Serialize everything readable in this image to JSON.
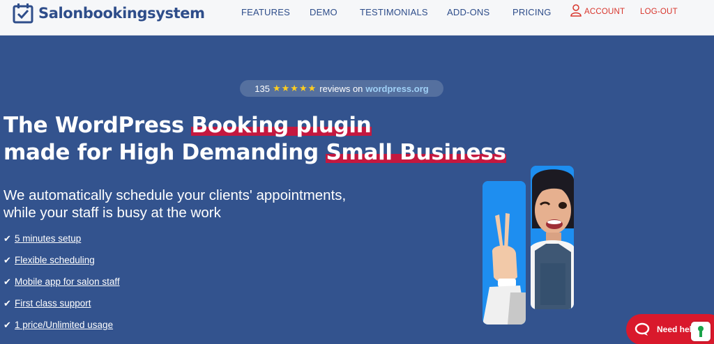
{
  "brand": {
    "name": "Salonbookingsystem"
  },
  "nav": {
    "features": "FEATURES",
    "demo": "DEMO",
    "testimonials": "TESTIMONIALS",
    "addons": "ADD-ONS",
    "pricing": "PRICING",
    "account": "ACCOUNT",
    "logout": "LOG-OUT"
  },
  "reviews": {
    "count": "135",
    "stars": "★★★★★",
    "rating": 5,
    "text": "reviews on",
    "source": "wordpress.org"
  },
  "hero": {
    "line1_a": "The WordPress ",
    "line1_b": "Booking plugin",
    "line2_a": "made for High Demanding ",
    "line2_b": "Small Business",
    "sub1": "We automatically schedule your clients' appointments,",
    "sub2": "while your staff is busy at the work"
  },
  "features": [
    {
      "label": " 5 minutes setup"
    },
    {
      "label": " Flexible scheduling"
    },
    {
      "label": " Mobile app for salon staff"
    },
    {
      "label": " First class support"
    },
    {
      "label": " 1 price/Unlimited usage"
    }
  ],
  "help": {
    "label": "Need help"
  },
  "colors": {
    "hero_bg": "#33538e",
    "brand_blue": "#2e4d8a",
    "highlight_red": "#c4183f",
    "star_yellow": "#ffcd1f",
    "help_red": "#d9192c",
    "photo_blue": "#1e8ef0"
  },
  "icons": {
    "logo": "calendar-check-icon",
    "account": "user-icon",
    "feature": "check-icon",
    "help": "chat-bubble-icon"
  }
}
